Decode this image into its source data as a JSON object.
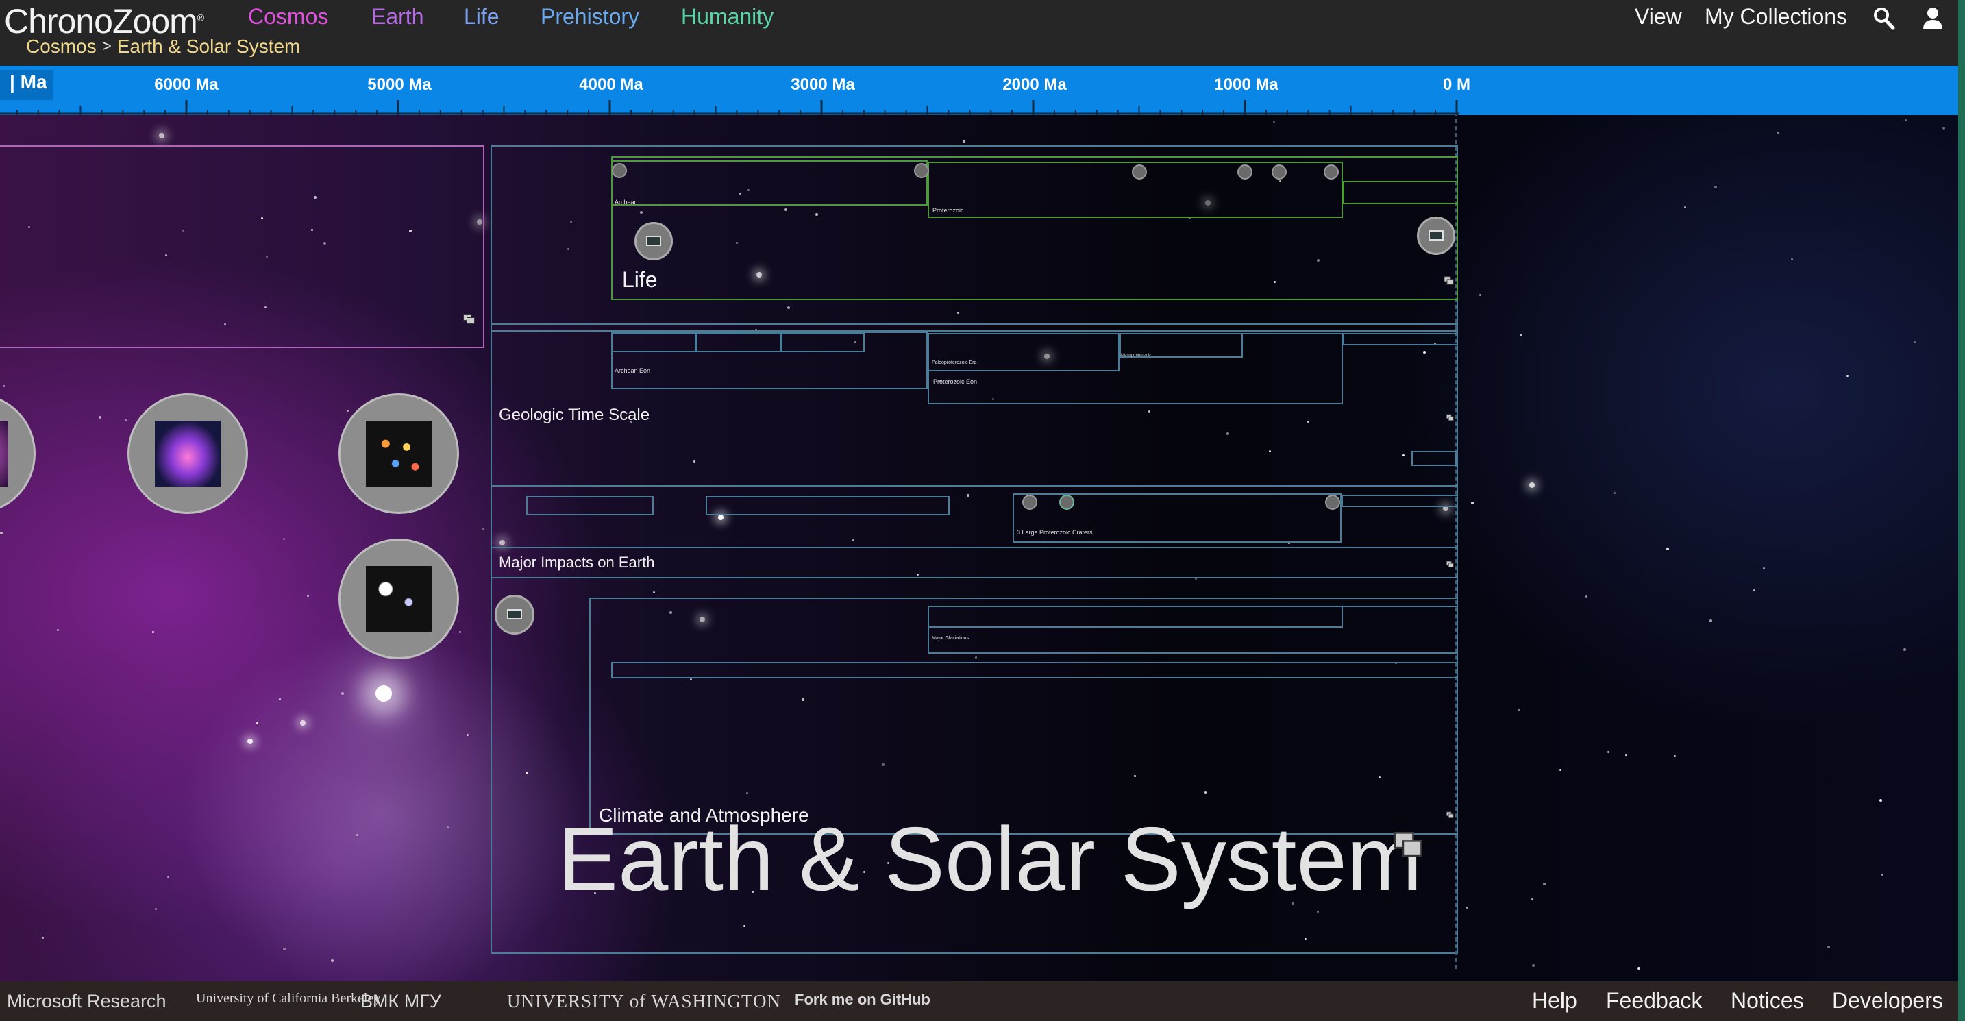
{
  "header": {
    "logo": "ChronoZoom",
    "logo_mark": "®",
    "nav": [
      {
        "label": "Cosmos",
        "color": "#e24fe0"
      },
      {
        "label": "Earth",
        "color": "#b86ae6"
      },
      {
        "label": "Life",
        "color": "#7a9ef0"
      },
      {
        "label": "Prehistory",
        "color": "#6aa9f0"
      },
      {
        "label": "Humanity",
        "color": "#58d6a8"
      }
    ],
    "breadcrumb": {
      "items": [
        "Cosmos",
        "Earth & Solar System"
      ],
      "separator": ">"
    },
    "right": {
      "view": "View",
      "collections": "My Collections"
    },
    "icons": {
      "search": "search-icon",
      "user": "user-icon"
    }
  },
  "ruler": {
    "edge_label": "Ma",
    "ticks": [
      "6000 Ma",
      "5000 Ma",
      "4000 Ma",
      "3000 Ma",
      "2000 Ma",
      "1000 Ma",
      "0 M"
    ],
    "color": "#0a86e6"
  },
  "timelines": {
    "life": {
      "title": "Life",
      "sub": [
        "Archean",
        "Proterozoic"
      ]
    },
    "geologic": {
      "title": "Geologic Time Scale",
      "sub": [
        "Archean Eon",
        "Paleoproterozoic Era",
        "Proterozoic Eon",
        "Mesoproterozoic"
      ]
    },
    "impacts": {
      "title": "Major Impacts on Earth",
      "sub": [
        "3 Large Proterozoic Craters"
      ]
    },
    "climate": {
      "title": "Climate and Atmosphere",
      "sub": [
        "Major Glaciations"
      ]
    },
    "main_title": "Earth & Solar System"
  },
  "footer": {
    "partners": [
      "Microsoft Research",
      "University of California Berkeley",
      "ВМК МГУ",
      "UNIVERSITY of WASHINGTON",
      "Fork me on GitHub"
    ],
    "links": [
      "Help",
      "Feedback",
      "Notices",
      "Developers"
    ]
  }
}
